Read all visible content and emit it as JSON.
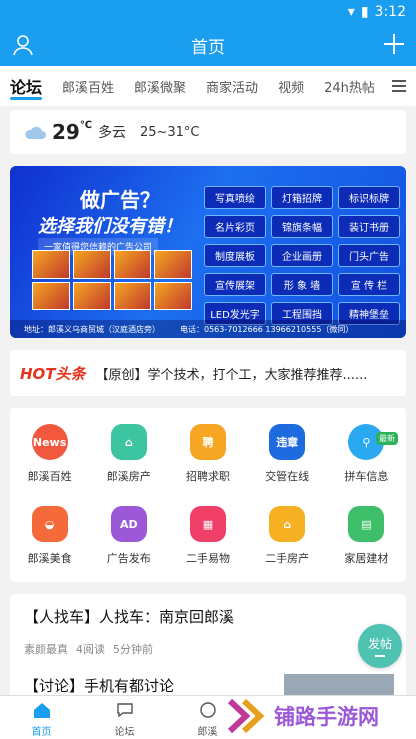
{
  "status_bar": {
    "time": "3:12"
  },
  "app_bar": {
    "title": "首页"
  },
  "tabs": [
    "论坛",
    "郎溪百姓",
    "郎溪微聚",
    "商家活动",
    "视频",
    "24h热帖"
  ],
  "weather": {
    "temp": "29",
    "unit": "℃",
    "condition": "多云",
    "range": "25~31°C"
  },
  "banner": {
    "title": "做广告？",
    "subtitle": "选择我们没有错！",
    "tagline": "一家值得您信赖的广告公司",
    "services": [
      "写真喷绘",
      "灯箱招牌",
      "标识标牌",
      "名片彩页",
      "锦旗条幅",
      "装订书册",
      "制度展板",
      "企业画册",
      "门头广告",
      "宣传展架",
      "形 象 墙",
      "宣 传 栏",
      "LED发光字",
      "工程围挡",
      "精神堡垒"
    ],
    "address": "地址：郎溪义乌商贸城（汉庭酒店旁）",
    "phone": "电话：0563-7012666  13966210555（微同）"
  },
  "headline": {
    "source_logo": "HOT头条",
    "text": "【原创】学个技术，打个工，大家推荐推荐......"
  },
  "grid_items": [
    {
      "label": "郎溪百姓",
      "icon": "news-icon",
      "color": "#f2583e",
      "icon_text": "News"
    },
    {
      "label": "郎溪房产",
      "icon": "house-icon",
      "color": "#3dc4a0",
      "icon_text": "⌂"
    },
    {
      "label": "招聘求职",
      "icon": "recruit-icon",
      "color": "#f6a623",
      "icon_text": "聘"
    },
    {
      "label": "交管在线",
      "icon": "traffic-icon",
      "color": "#1e6be0",
      "icon_text": "违章"
    },
    {
      "label": "拼车信息",
      "icon": "carpool-icon",
      "color": "#2aa8f0",
      "icon_text": "⚲",
      "badge": "最新"
    },
    {
      "label": "郎溪美食",
      "icon": "food-icon",
      "color": "#f56a3a",
      "icon_text": "◒"
    },
    {
      "label": "广告发布",
      "icon": "ad-icon",
      "color": "#9b59d8",
      "icon_text": "AD"
    },
    {
      "label": "二手易物",
      "icon": "gift-icon",
      "color": "#f0406a",
      "icon_text": "▦"
    },
    {
      "label": "二手房产",
      "icon": "home-icon",
      "color": "#f6b022",
      "icon_text": "⌂"
    },
    {
      "label": "家居建材",
      "icon": "paint-icon",
      "color": "#3fbf6a",
      "icon_text": "▤"
    }
  ],
  "posts": [
    {
      "title": "【人找车】人找车：南京回郎溪",
      "author": "素颜最真",
      "reads": "4阅读",
      "time": "5分钟前"
    },
    {
      "title": "【讨论】手机有都讨论"
    }
  ],
  "fab": {
    "label": "发帖"
  },
  "bottom_nav": [
    "首页",
    "论坛",
    "郎溪"
  ],
  "watermark": {
    "text": "铺路手游网"
  }
}
